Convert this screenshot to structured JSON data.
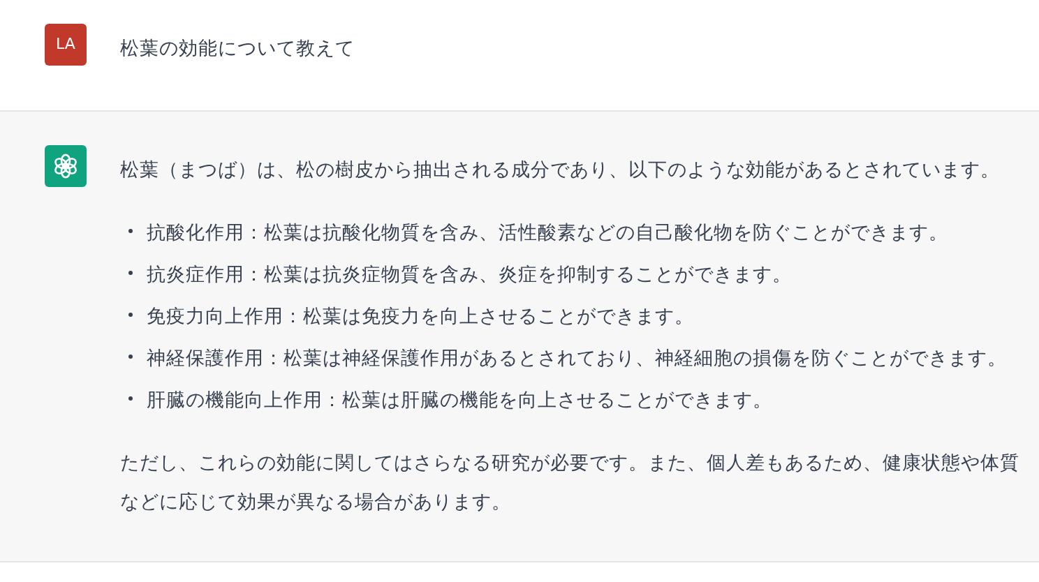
{
  "messages": [
    {
      "kind": "user",
      "avatar": "LA",
      "paragraphs": [
        {
          "kind": "text",
          "text": "松葉の効能について教えて"
        }
      ]
    },
    {
      "kind": "assistant",
      "paragraphs": [
        {
          "kind": "text",
          "text": "松葉（まつば）は、松の樹皮から抽出される成分であり、以下のような効能があるとされています。"
        },
        {
          "kind": "list",
          "items": [
            "抗酸化作用：松葉は抗酸化物質を含み、活性酸素などの自己酸化物を防ぐことができます。",
            "抗炎症作用：松葉は抗炎症物質を含み、炎症を抑制することができます。",
            "免疫力向上作用：松葉は免疫力を向上させることができます。",
            "神経保護作用：松葉は神経保護作用があるとされており、神経細胞の損傷を防ぐことができます。",
            "肝臓の機能向上作用：松葉は肝臓の機能を向上させることができます。"
          ]
        },
        {
          "kind": "text",
          "text": "ただし、これらの効能に関してはさらなる研究が必要です。また、個人差もあるため、健康状態や体質などに応じて効果が異なる場合があります。"
        }
      ]
    }
  ]
}
